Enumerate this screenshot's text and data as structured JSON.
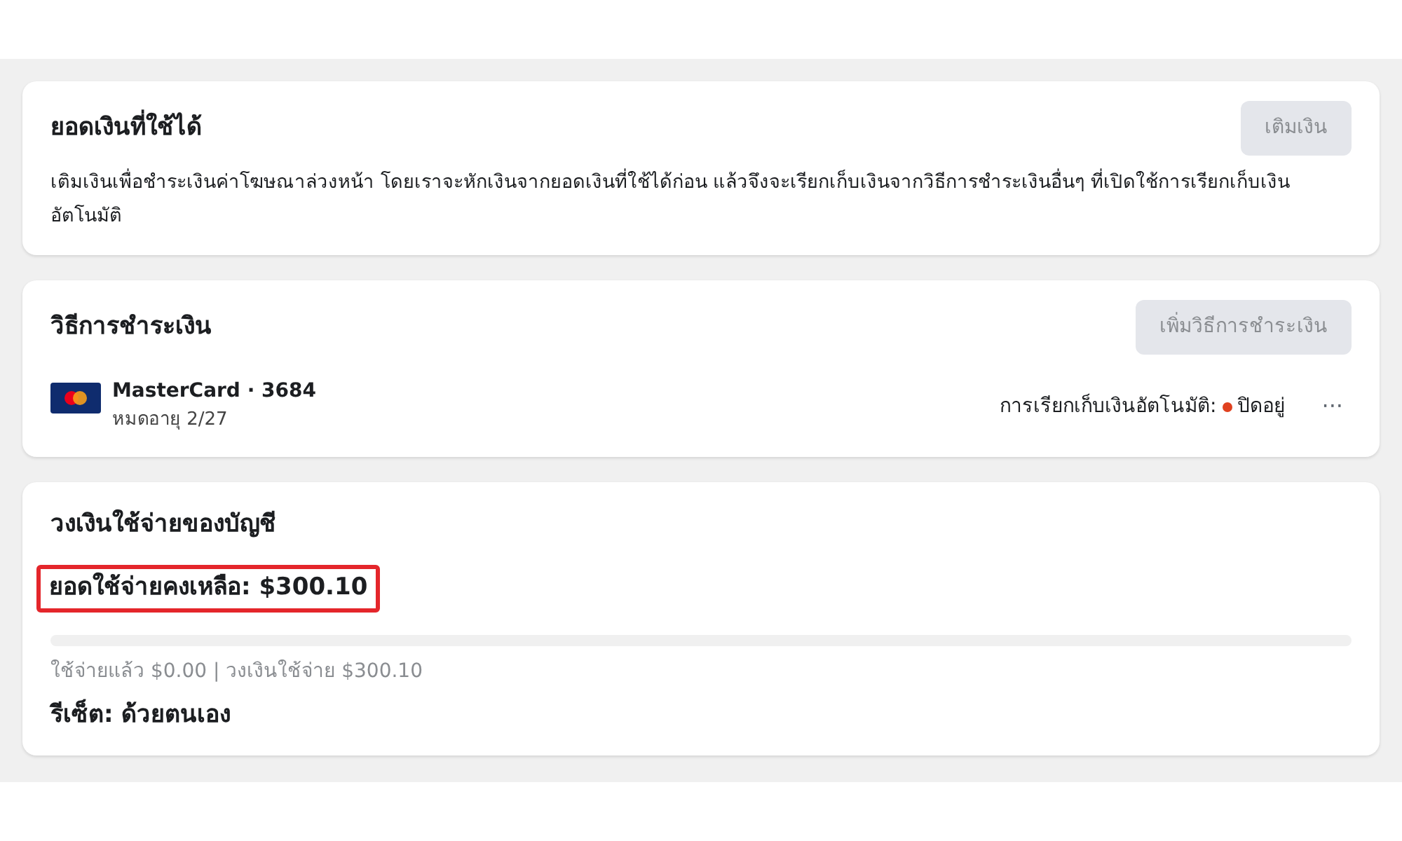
{
  "balance_card": {
    "title": "ยอดเงินที่ใช้ได้",
    "button": {
      "label": "เติมเงิน",
      "disabled": true
    },
    "description": "เติมเงินเพื่อชำระเงินค่าโฆษณาล่วงหน้า โดยเราจะหักเงินจากยอดเงินที่ใช้ได้ก่อน แล้วจึงจะเรียกเก็บเงินจากวิธีการชำระเงินอื่นๆ ที่เปิดใช้การเรียกเก็บเงินอัตโนมัติ"
  },
  "payment_card": {
    "title": "วิธีการชำระเงิน",
    "button": {
      "label": "เพิ่มวิธีการชำระเงิน",
      "disabled": true
    },
    "methods": [
      {
        "name": "MasterCard · 3684",
        "expiry": "หมดอายุ 2/27",
        "auto_label": "การเรียกเก็บเงินอัตโนมัติ:",
        "status": "ปิดอยู่",
        "color": "#e0411f",
        "menu": "···"
      }
    ]
  },
  "limit_card": {
    "title": "วงเงินใช้จ่ายของบัญชี",
    "remaining": "ยอดใช้จ่ายคงเหลือ: $300.10",
    "highlighted": true,
    "level": 0,
    "usage": "ใช้จ่ายแล้ว $0.00 | วงเงินใช้จ่าย $300.10",
    "reset": "รีเซ็ต: ด้วยตนเอง"
  }
}
